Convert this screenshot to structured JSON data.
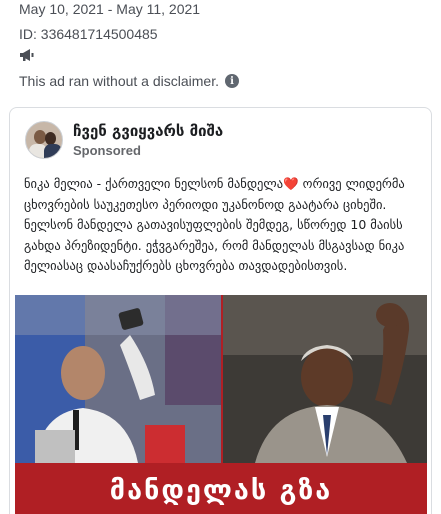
{
  "ad_meta": {
    "date_range": "May 10, 2021 - May 11, 2021",
    "id_text": "ID: 336481714500485",
    "disclaimer_text": "This ad ran without a disclaimer.",
    "info_icon_glyph": "i",
    "icons": {
      "megaphone": "megaphone-icon",
      "info": "info-icon"
    }
  },
  "post": {
    "page_name": "ჩვენ გვიყვარს მიშა",
    "sponsored_label": "Sponsored",
    "text_before_emoji": "ნიკა მელია - ქართველი ნელსონ მანდელა",
    "heart_glyph": "❤️",
    "text_after_emoji": " ორივე ლიდერმა ცხოვრების საუკეთესო პერიოდი უკანონოდ გაატარა ციხეში. ნელსონ მანდელა გათავისუფლების შემდეგ, სწორედ 10 მაისს გახდა პრეზიდენტი. ეჭვგარეშეა, რომ მანდელას მსგავსად ნიკა მელიასაც დაასაჩუქრებს ცხოვრება თავდადებისთვის.",
    "image_caption": "მანდელას გზა"
  },
  "colors": {
    "meta_text": "#4b4f56",
    "banner_red": "#b01f24",
    "sponsored_gray": "#65676b",
    "heart_red": "#e0245e"
  }
}
